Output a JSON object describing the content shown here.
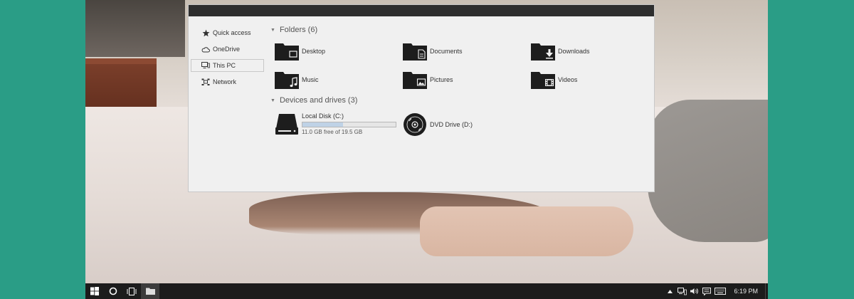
{
  "sidebar": {
    "items": [
      {
        "label": "Quick access",
        "icon": "star-icon"
      },
      {
        "label": "OneDrive",
        "icon": "cloud-icon"
      },
      {
        "label": "This PC",
        "icon": "computer-icon",
        "selected": true
      },
      {
        "label": "Network",
        "icon": "network-icon"
      }
    ]
  },
  "folders": {
    "header": "Folders (6)",
    "items": [
      {
        "label": "Desktop",
        "icon": "desktop-folder-icon"
      },
      {
        "label": "Documents",
        "icon": "documents-folder-icon"
      },
      {
        "label": "Downloads",
        "icon": "downloads-folder-icon"
      },
      {
        "label": "Music",
        "icon": "music-folder-icon"
      },
      {
        "label": "Pictures",
        "icon": "pictures-folder-icon"
      },
      {
        "label": "Videos",
        "icon": "videos-folder-icon"
      }
    ]
  },
  "drives": {
    "header": "Devices and drives (3)",
    "local_disk": {
      "label": "Local Disk (C:)",
      "free_text": "11.0 GB free of 19.5 GB",
      "used_fraction": 0.436
    },
    "dvd": {
      "label": "DVD Drive (D:)"
    }
  },
  "taskbar": {
    "buttons": [
      "windows-start-icon",
      "cortana-icon",
      "task-view-icon",
      "file-explorer-icon"
    ],
    "tray": [
      "show-hidden-icons",
      "network-icon",
      "volume-icon",
      "notifications-icon",
      "keyboard-icon"
    ],
    "clock": "6:19 PM"
  },
  "colors": {
    "frame": "#2a9d86",
    "titlebar": "#2e2e2e",
    "taskbar": "#1c1c1c",
    "window": "#f0f0f0",
    "drive_bar": "#bfd2e6"
  }
}
